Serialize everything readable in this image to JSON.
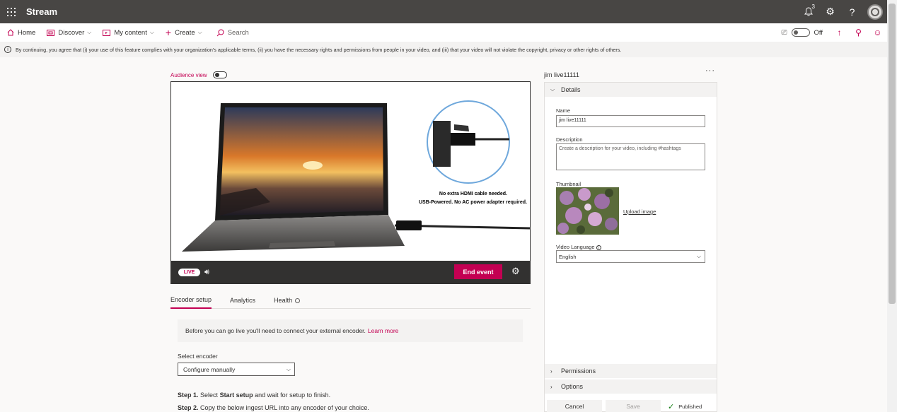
{
  "app": {
    "title": "Stream",
    "notification_count": "3"
  },
  "nav": {
    "home": "Home",
    "discover": "Discover",
    "my_content": "My content",
    "create": "Create",
    "search_placeholder": "Search",
    "toggle_state": "Off"
  },
  "banner": {
    "text": "By continuing, you agree that (i) your use of this feature complies with your organization's applicable terms, (ii) you have the necessary rights and permissions from people in your video, and (iii) that your video will not violate the copyright, privacy or other rights of others."
  },
  "player": {
    "audience_view_label": "Audience view",
    "caption_line1": "No extra HDMI cable needed.",
    "caption_line2": "USB-Powered. No AC power adapter required.",
    "live_label": "LIVE",
    "end_event_label": "End event"
  },
  "tabs": [
    {
      "label": "Encoder setup",
      "active": true
    },
    {
      "label": "Analytics",
      "active": false
    },
    {
      "label": "Health",
      "active": false
    }
  ],
  "encoder": {
    "notice_text": "Before you can go live you'll need to connect your external encoder.",
    "learn_more": "Learn more",
    "select_label": "Select encoder",
    "select_value": "Configure manually",
    "step1_prefix": "Step 1.",
    "step1_a": "Select",
    "step1_bold": "Start setup",
    "step1_b": "and wait for setup to finish.",
    "step2_prefix": "Step 2.",
    "step2_text": "Copy the below ingest URL into any encoder of your choice."
  },
  "details_panel": {
    "title": "jim live11111",
    "details_header": "Details",
    "name_label": "Name",
    "name_value": "jim live11111",
    "description_label": "Description",
    "description_placeholder": "Create a description for your video, including #hashtags",
    "thumbnail_label": "Thumbnail",
    "upload_image": "Upload image",
    "video_language_label": "Video Language",
    "video_language_value": "English",
    "permissions_header": "Permissions",
    "options_header": "Options",
    "cancel_label": "Cancel",
    "save_label": "Save",
    "published_label": "Published"
  },
  "colors": {
    "accent": "#c30052",
    "appbar": "#484644",
    "success": "#107c10"
  }
}
